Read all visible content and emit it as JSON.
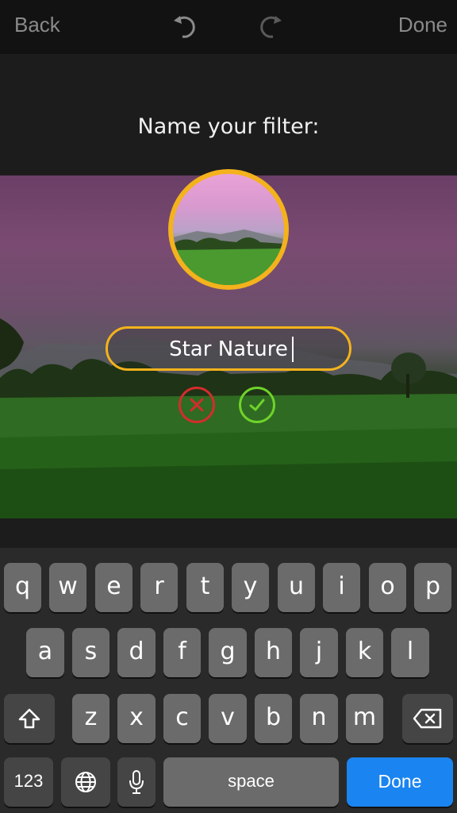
{
  "toolbar": {
    "back_label": "Back",
    "done_label": "Done",
    "undo_icon": "undo-icon",
    "redo_icon": "redo-icon"
  },
  "dialog": {
    "prompt": "Name your filter:",
    "filter_name_value": "Star Nature",
    "cancel_icon": "x-icon",
    "confirm_icon": "check-icon",
    "accent_color": "#f4b21c",
    "cancel_color": "#d42c2c",
    "confirm_color": "#6fd32a"
  },
  "keyboard": {
    "row1": [
      "q",
      "w",
      "e",
      "r",
      "t",
      "y",
      "u",
      "i",
      "o",
      "p"
    ],
    "row2": [
      "a",
      "s",
      "d",
      "f",
      "g",
      "h",
      "j",
      "k",
      "l"
    ],
    "row3": [
      "z",
      "x",
      "c",
      "v",
      "b",
      "n",
      "m"
    ],
    "numbers_label": "123",
    "space_label": "space",
    "done_label": "Done",
    "done_color": "#1a84f0"
  }
}
